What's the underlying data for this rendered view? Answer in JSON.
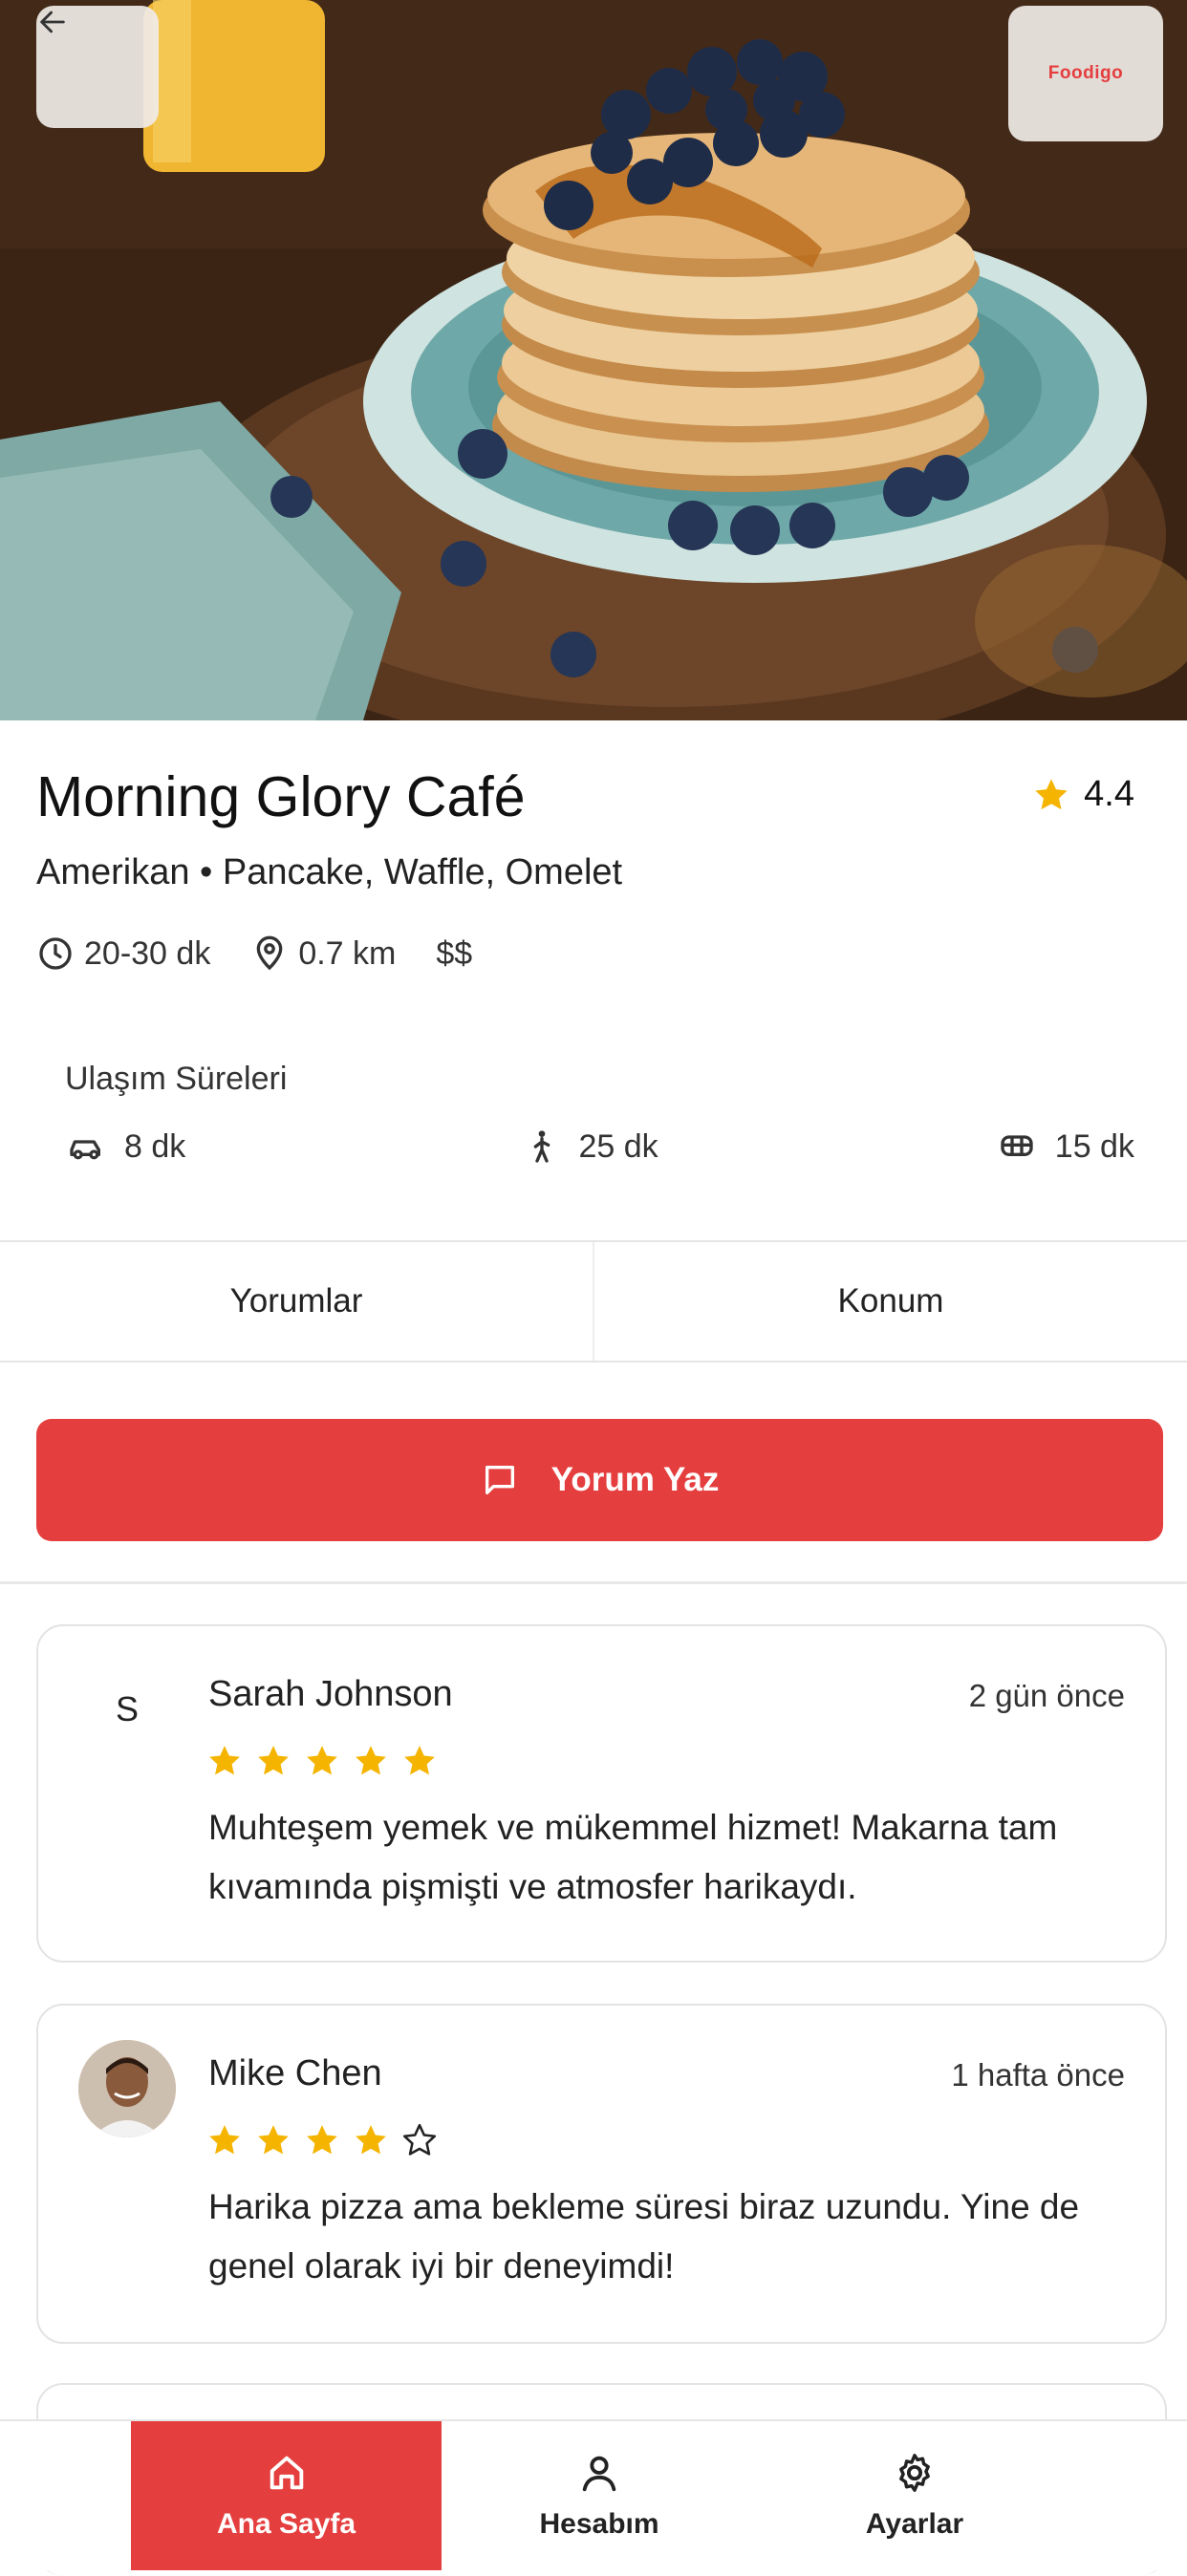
{
  "header": {
    "logo_text": "Foodigo"
  },
  "restaurant": {
    "name": "Morning Glory Café",
    "rating": "4.4",
    "cuisine": "Amerikan • Pancake, Waffle, Omelet",
    "delivery_time": "20-30 dk",
    "distance": "0.7 km",
    "price": "$$"
  },
  "transit": {
    "title": "Ulaşım Süreleri",
    "car": "8 dk",
    "walk": "25 dk",
    "bus": "15 dk"
  },
  "tabs": [
    {
      "label": "Yorumlar"
    },
    {
      "label": "Konum"
    }
  ],
  "write_review_label": "Yorum Yaz",
  "reviews": [
    {
      "initial": "S",
      "name": "Sarah Johnson",
      "time": "2 gün önce",
      "rating": 5,
      "text": "Muhteşem yemek ve mükemmel hizmet! Makarna tam kıvamında pişmişti ve atmosfer harikaydı."
    },
    {
      "name": "Mike Chen",
      "time": "1 hafta önce",
      "rating": 4,
      "text": "Harika pizza ama bekleme süresi biraz uzundu. Yine de genel olarak iyi bir deneyimdi!"
    }
  ],
  "nav": [
    {
      "label": "Ana Sayfa",
      "icon": "home-icon"
    },
    {
      "label": "Hesabım",
      "icon": "user-icon"
    },
    {
      "label": "Ayarlar",
      "icon": "gear-icon"
    }
  ],
  "colors": {
    "accent": "#e53e3e",
    "star": "#f5b400"
  }
}
